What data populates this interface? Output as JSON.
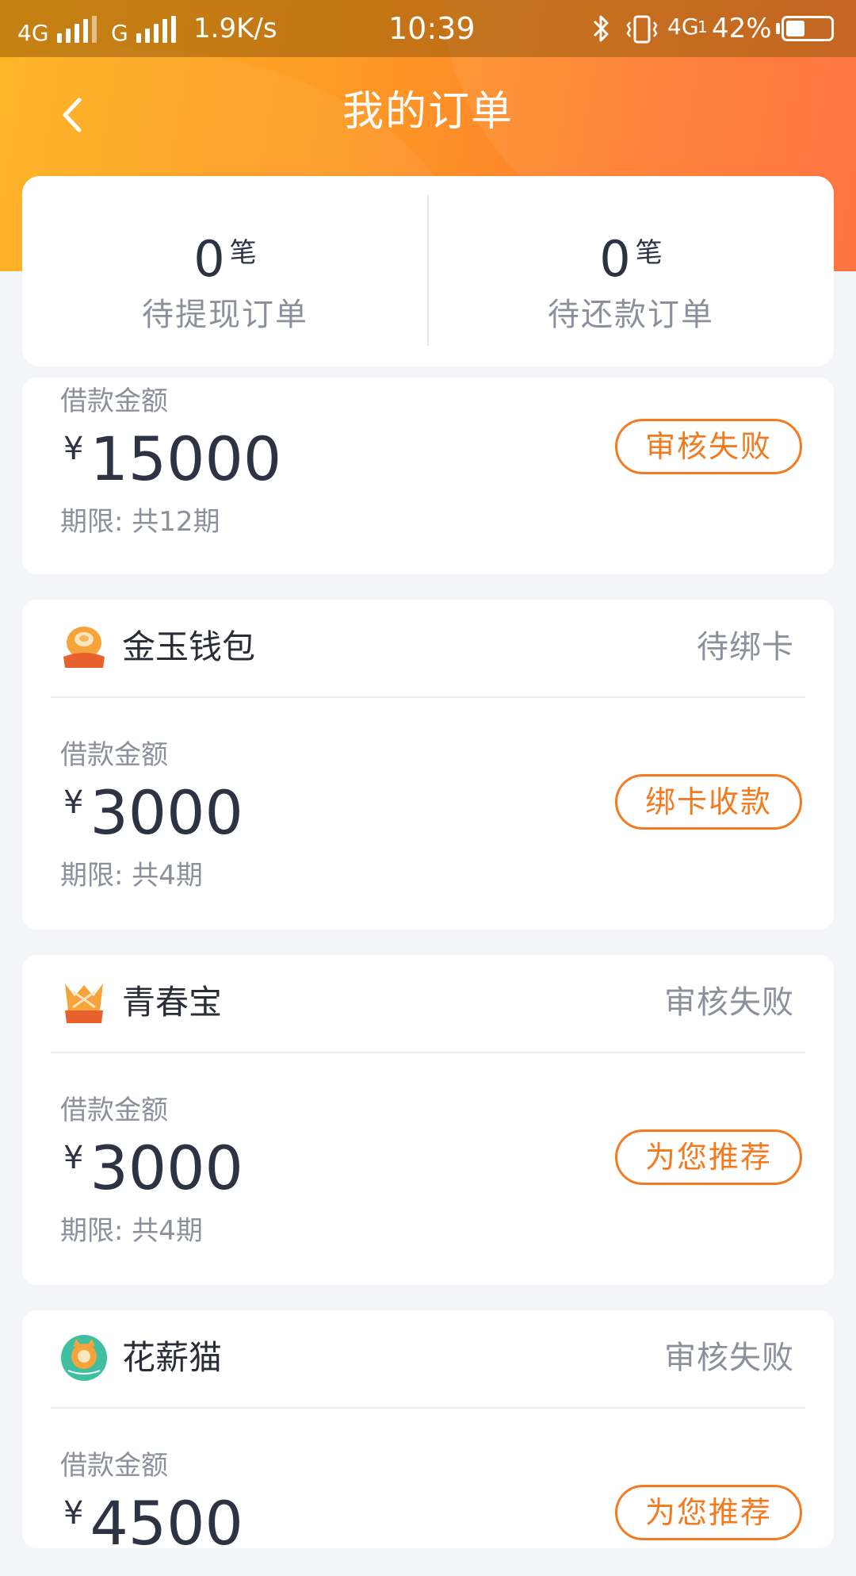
{
  "status_bar": {
    "network1": "4G",
    "network2": "G",
    "speed": "1.9K/s",
    "time": "10:39",
    "network3": "4G",
    "network3_sub": "1",
    "battery": "42%",
    "battery_level": 0.42,
    "icons": [
      "signal-icon",
      "bluetooth-icon",
      "vibrate-icon",
      "battery-icon"
    ]
  },
  "nav": {
    "back_icon": "chevron-left-icon",
    "title": "我的订单"
  },
  "summary": {
    "pending_withdraw": {
      "count": "0",
      "unit": "笔",
      "label": "待提现订单"
    },
    "pending_repay": {
      "count": "0",
      "unit": "笔",
      "label": "待还款订单"
    }
  },
  "orders": [
    {
      "amount_label": "借款金额",
      "currency": "¥",
      "amount": "15000",
      "term": "期限: 共12期",
      "action": "审核失败"
    },
    {
      "app_name": "金玉钱包",
      "app_logo": "golden-egg-logo",
      "status": "待绑卡",
      "amount_label": "借款金额",
      "currency": "¥",
      "amount": "3000",
      "term": "期限: 共4期",
      "action": "绑卡收款"
    },
    {
      "app_name": "青春宝",
      "app_logo": "crown-logo",
      "status": "审核失败",
      "amount_label": "借款金额",
      "currency": "¥",
      "amount": "3000",
      "term": "期限: 共4期",
      "action": "为您推荐"
    },
    {
      "app_name": "花薪猫",
      "app_logo": "cat-logo",
      "status": "审核失败",
      "amount_label": "借款金额",
      "currency": "¥",
      "amount": "4500",
      "action": "为您推荐"
    }
  ],
  "colors": {
    "accent": "#f47a20",
    "header_start": "#fdb21d",
    "header_end": "#ff6a33",
    "text_dark": "#2e3243",
    "text_gray": "#8c909c",
    "background": "#f3f5f8"
  }
}
